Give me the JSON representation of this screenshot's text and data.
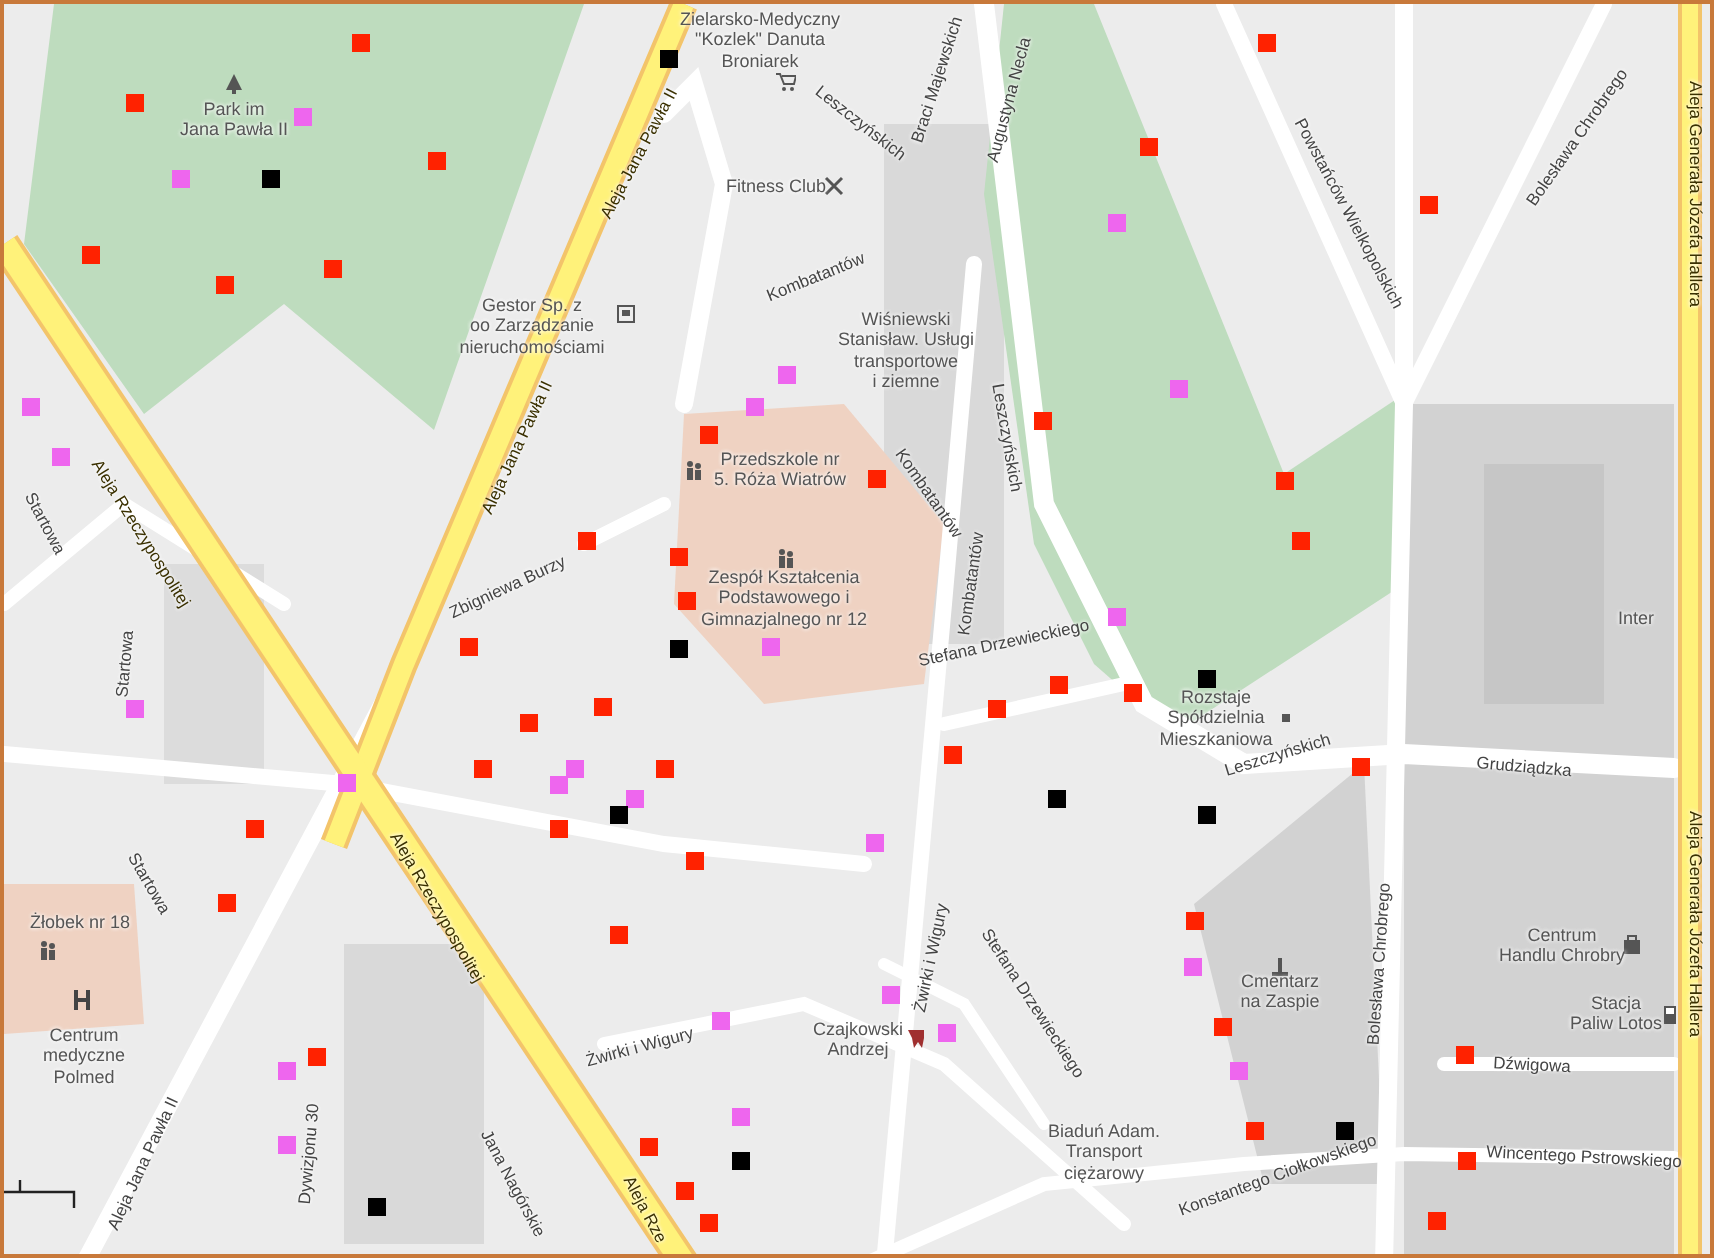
{
  "map": {
    "labels": [
      {
        "kind": "poi",
        "text": "Zielarsko-Medyczny\n\"Kozlek\" Danuta\nBroniarek"
      },
      {
        "kind": "poi",
        "text": "Park im\nJana Pawła II"
      },
      {
        "kind": "poi",
        "text": "Fitness Club"
      },
      {
        "kind": "poi",
        "text": "Gestor Sp. z\noo Zarządzanie\nnieruchomościami"
      },
      {
        "kind": "road",
        "text": "Aleja Jana Pawła II"
      },
      {
        "kind": "road",
        "text": "Aleja Jana Pawła II"
      },
      {
        "kind": "road",
        "text": "Aleja Rzeczypospolitej"
      },
      {
        "kind": "road",
        "text": "Aleja Rzeczypospolitej"
      },
      {
        "kind": "road",
        "text": "Aleja Rze"
      },
      {
        "kind": "street",
        "text": "Startowa"
      },
      {
        "kind": "street",
        "text": "Startowa"
      },
      {
        "kind": "street",
        "text": "Startowa"
      },
      {
        "kind": "street",
        "text": "Kombatantów"
      },
      {
        "kind": "street",
        "text": "Kombatantów"
      },
      {
        "kind": "street",
        "text": "Kombatantów"
      },
      {
        "kind": "poi",
        "text": "Przedszkole nr\n5. Róża Wiatrów"
      },
      {
        "kind": "poi",
        "text": "Zespół Kształcenia\nPodstawowego i\nGimnazjalnego nr 12"
      },
      {
        "kind": "street",
        "text": "Zbigniewa Burzy"
      },
      {
        "kind": "street",
        "text": "Leszczyńskich"
      },
      {
        "kind": "street",
        "text": "Braci Majewskich"
      },
      {
        "kind": "street",
        "text": "Augustyna Necla"
      },
      {
        "kind": "poi",
        "text": "Wiśniewski\nStanisław. Usługi\ntransportowe\ni ziemne"
      },
      {
        "kind": "street",
        "text": "Leszczyńskich"
      },
      {
        "kind": "street",
        "text": "Powstańców Wielkopolskich"
      },
      {
        "kind": "street",
        "text": "Bolesława Chrobrego"
      },
      {
        "kind": "road",
        "text": "Aleja Generała Józefa Hallera"
      },
      {
        "kind": "poi",
        "text": "Inter"
      },
      {
        "kind": "street",
        "text": "Stefana Drzewieckiego"
      },
      {
        "kind": "poi",
        "text": "Rozstaje\nSpółdzielnia\nMieszkaniowa"
      },
      {
        "kind": "street",
        "text": "Leszczyńskich"
      },
      {
        "kind": "street",
        "text": "Grudziądzka"
      },
      {
        "kind": "road",
        "text": "Aleja Generała Józefa Hallera"
      },
      {
        "kind": "street",
        "text": "Bolesława Chrobrego"
      },
      {
        "kind": "poi",
        "text": "Centrum\nHandlu Chrobry"
      },
      {
        "kind": "poi",
        "text": "Stacja\nPaliw Lotos"
      },
      {
        "kind": "poi",
        "text": "Cmentarz\nna Zaspie"
      },
      {
        "kind": "street",
        "text": "Dźwigowa"
      },
      {
        "kind": "street",
        "text": "Wincentego Pstrowskiego"
      },
      {
        "kind": "street",
        "text": "Konstantego Ciołkowskiego"
      },
      {
        "kind": "poi",
        "text": "Biaduń Adam.\nTransport\nciężarowy"
      },
      {
        "kind": "street",
        "text": "Stefana Drzewieckiego"
      },
      {
        "kind": "street",
        "text": "Żwirki i Wigury"
      },
      {
        "kind": "poi",
        "text": "Czajkowski\nAndrzej"
      },
      {
        "kind": "street",
        "text": "Żwirki i Wigury"
      },
      {
        "kind": "street",
        "text": "Dywizjonu 30"
      },
      {
        "kind": "street",
        "text": "Jana Nagórskie"
      },
      {
        "kind": "poi",
        "text": "Żłobek nr 18"
      },
      {
        "kind": "poi",
        "text": "Centrum\nmedyczne\nPolmed"
      },
      {
        "kind": "street",
        "text": "Aleja Jana Pawła II"
      }
    ],
    "markers": [
      {
        "color": "#ff2200"
      },
      {
        "color": "#ff2200"
      },
      {
        "color": "#ff2200"
      },
      {
        "color": "#ff2200"
      },
      {
        "color": "#ff2200"
      },
      {
        "color": "#ff2200"
      },
      {
        "color": "#ff2200"
      },
      {
        "color": "#ff2200"
      },
      {
        "color": "#ff2200"
      },
      {
        "color": "#ff2200"
      },
      {
        "color": "#ff2200"
      },
      {
        "color": "#ff2200"
      },
      {
        "color": "#ff2200"
      },
      {
        "color": "#ff2200"
      },
      {
        "color": "#ff2200"
      },
      {
        "color": "#ff2200"
      },
      {
        "color": "#ff2200"
      },
      {
        "color": "#ff2200"
      },
      {
        "color": "#ff2200"
      },
      {
        "color": "#ff2200"
      },
      {
        "color": "#ff2200"
      },
      {
        "color": "#ff2200"
      },
      {
        "color": "#ff2200"
      },
      {
        "color": "#ff2200"
      },
      {
        "color": "#ff2200"
      },
      {
        "color": "#ff2200"
      },
      {
        "color": "#ff2200"
      },
      {
        "color": "#ff2200"
      },
      {
        "color": "#ff2200"
      },
      {
        "color": "#ff2200"
      },
      {
        "color": "#ff2200"
      },
      {
        "color": "#ff2200"
      },
      {
        "color": "#ff2200"
      },
      {
        "color": "#ff2200"
      },
      {
        "color": "#ff2200"
      },
      {
        "color": "#ff2200"
      },
      {
        "color": "#ff2200"
      },
      {
        "color": "#ff2200"
      },
      {
        "color": "#ff2200"
      },
      {
        "color": "#ff2200"
      },
      {
        "color": "#ff2200"
      },
      {
        "color": "#ff2200"
      },
      {
        "color": "#ee66ee"
      },
      {
        "color": "#ee66ee"
      },
      {
        "color": "#ee66ee"
      },
      {
        "color": "#ee66ee"
      },
      {
        "color": "#ee66ee"
      },
      {
        "color": "#ee66ee"
      },
      {
        "color": "#ee66ee"
      },
      {
        "color": "#ee66ee"
      },
      {
        "color": "#ee66ee"
      },
      {
        "color": "#ee66ee"
      },
      {
        "color": "#ee66ee"
      },
      {
        "color": "#ee66ee"
      },
      {
        "color": "#ee66ee"
      },
      {
        "color": "#ee66ee"
      },
      {
        "color": "#ee66ee"
      },
      {
        "color": "#ee66ee"
      },
      {
        "color": "#ee66ee"
      },
      {
        "color": "#ee66ee"
      },
      {
        "color": "#ee66ee"
      },
      {
        "color": "#ee66ee"
      },
      {
        "color": "#ee66ee"
      },
      {
        "color": "#ee66ee"
      },
      {
        "color": "#ee66ee"
      },
      {
        "color": "#ee66ee"
      },
      {
        "color": "#000000"
      },
      {
        "color": "#000000"
      },
      {
        "color": "#000000"
      },
      {
        "color": "#000000"
      },
      {
        "color": "#000000"
      },
      {
        "color": "#000000"
      },
      {
        "color": "#000000"
      },
      {
        "color": "#000000"
      },
      {
        "color": "#000000"
      },
      {
        "color": "#000000"
      }
    ]
  }
}
